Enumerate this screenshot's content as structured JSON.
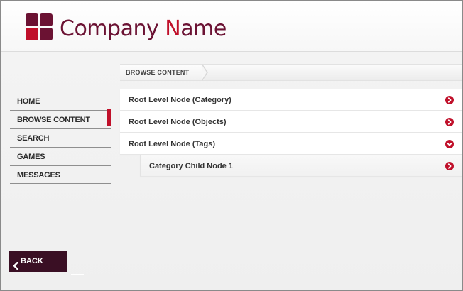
{
  "header": {
    "brand_prefix": "Company ",
    "brand_accent": "N",
    "brand_suffix": "ame"
  },
  "breadcrumb": {
    "current": "BROWSE CONTENT"
  },
  "nav": {
    "items": [
      {
        "label": "HOME"
      },
      {
        "label": "BROWSE CONTENT"
      },
      {
        "label": "SEARCH"
      },
      {
        "label": "GAMES"
      },
      {
        "label": "MESSAGES"
      }
    ],
    "active": "BROWSE CONTENT"
  },
  "tree": {
    "rows": [
      {
        "label": "Root Level Node (Category)",
        "icon": "chevron-right-icon"
      },
      {
        "label": "Root Level Node (Objects)",
        "icon": "chevron-right-icon"
      },
      {
        "label": "Root Level Node (Tags)",
        "icon": "chevron-down-icon"
      },
      {
        "label": "Category Child Node 1",
        "icon": "chevron-right-icon"
      }
    ]
  },
  "back_button": {
    "label": "BACK",
    "icon": "chevron-left-icon"
  },
  "colors": {
    "brand_dark": "#6b1233",
    "accent_red": "#c0102a",
    "back_bg": "#3a0f24"
  }
}
